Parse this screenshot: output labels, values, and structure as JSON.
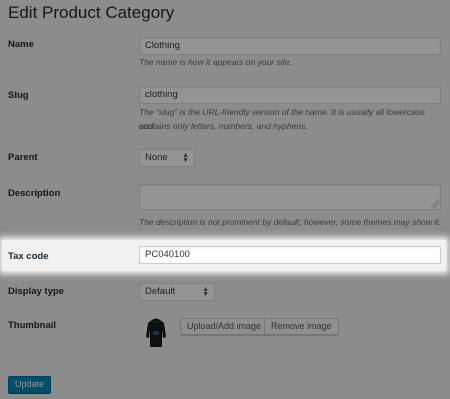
{
  "page": {
    "title": "Edit Product Category"
  },
  "fields": {
    "name": {
      "label": "Name",
      "value": "Clothing",
      "description": "The name is how it appears on your site."
    },
    "slug": {
      "label": "Slug",
      "value": "clothing",
      "description_line1": "The “slug” is the URL-friendly version of the name. It is usually all lowercase and",
      "description_line2": "contains only letters, numbers, and hyphens."
    },
    "parent": {
      "label": "Parent",
      "selected": "None"
    },
    "description": {
      "label": "Description",
      "value": "",
      "description": "The description is not prominent by default; however, some themes may show it."
    },
    "tax_code": {
      "label": "Tax code",
      "value": "PC040100"
    },
    "display_type": {
      "label": "Display type",
      "selected": "Default"
    },
    "thumbnail": {
      "label": "Thumbnail",
      "upload_button": "Upload/Add image",
      "remove_button": "Remove image",
      "image_icon": "hoodie-thumbnail"
    }
  },
  "actions": {
    "update_label": "Update"
  },
  "colors": {
    "primary_button": "#0085ba",
    "background": "#f1f1f1"
  }
}
